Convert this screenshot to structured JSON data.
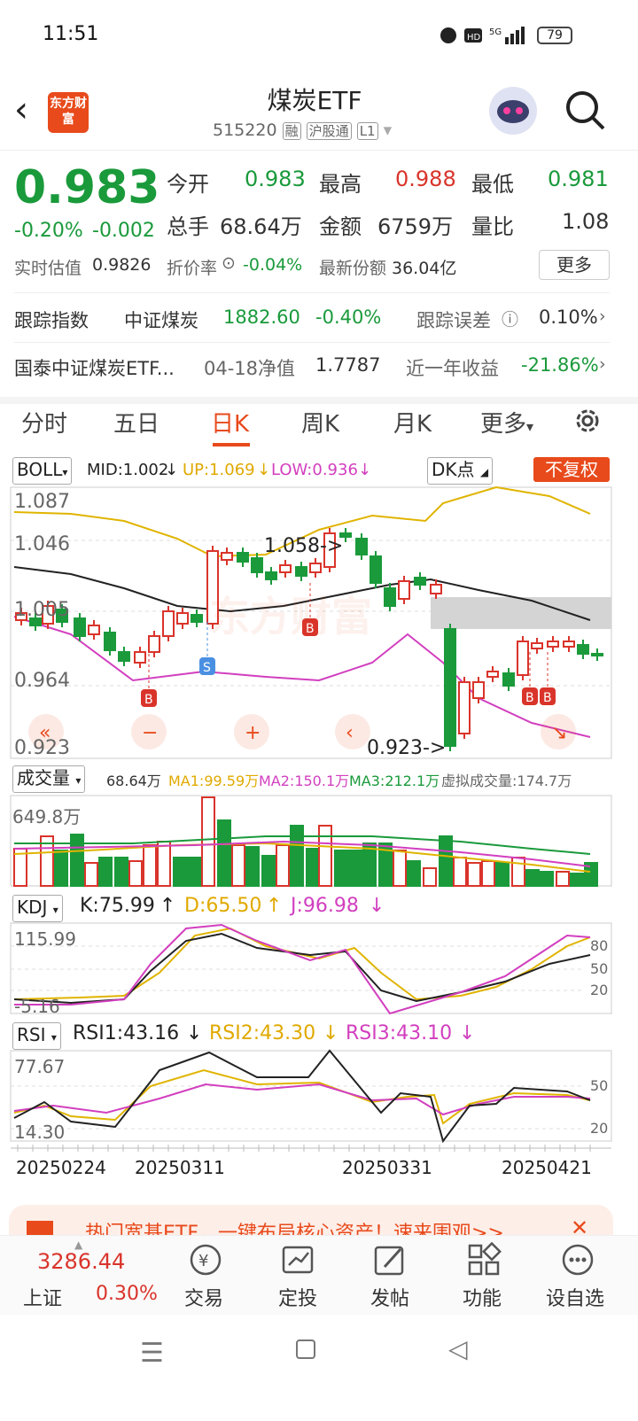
{
  "status": {
    "time": "11:51",
    "battery": "79"
  },
  "header": {
    "title": "煤炭ETF",
    "code": "515220",
    "tags": [
      "融",
      "沪股通",
      "L1"
    ],
    "logo": "东方财富"
  },
  "quote": {
    "price": "0.983",
    "pct": "-0.20%",
    "chg": "-0.002",
    "open_label": "今开",
    "open": "0.983",
    "high_label": "最高",
    "high": "0.988",
    "low_label": "最低",
    "low": "0.981",
    "vol_label": "总手",
    "vol": "68.64万",
    "amt_label": "金额",
    "amt": "6759万",
    "ratio_label": "量比",
    "ratio": "1.08",
    "iopv_label": "实时估值",
    "iopv": "0.9826",
    "prem_label": "折价率",
    "prem": "-0.04%",
    "share_label": "最新份额",
    "share": "36.04亿",
    "more": "更多"
  },
  "track": {
    "label": "跟踪指数",
    "index": "中证煤炭",
    "value": "1882.60",
    "pct": "-0.40%",
    "err_label": "跟踪误差",
    "err": "0.10%"
  },
  "fund": {
    "name": "国泰中证煤炭ETF...",
    "nav_label": "04-18净值",
    "nav": "1.7787",
    "ret_label": "近一年收益",
    "ret": "-21.86%"
  },
  "tabs": [
    "分时",
    "五日",
    "日K",
    "周K",
    "月K",
    "更多"
  ],
  "boll": {
    "name": "BOLL",
    "mid": "MID:1.002",
    "up": "UP:1.069",
    "low": "LOW:0.936",
    "dk": "DK点",
    "fq": "不复权",
    "axis": [
      "1.087",
      "1.046",
      "1.005",
      "0.964",
      "0.923"
    ],
    "max_note": "1.058->",
    "min_note": "0.923->",
    "marks": [
      "B",
      "S",
      "B",
      "B",
      "B"
    ],
    "watermark": "东方财富"
  },
  "volume": {
    "name": "成交量",
    "v": "68.64万",
    "ma1": "MA1:99.59万",
    "ma2": "MA2:150.1万",
    "ma3": "MA3:212.1万",
    "virt": "虚拟成交量:174.7万",
    "axis": "649.8万"
  },
  "kdj": {
    "name": "KDJ",
    "k": "K:75.99",
    "d": "D:65.50",
    "j": "J:96.98",
    "axis_top": "115.99",
    "axis_bot": "-5.16",
    "levels": [
      "80",
      "50",
      "20"
    ]
  },
  "rsi": {
    "name": "RSI",
    "r1": "RSI1:43.16",
    "r2": "RSI2:43.30",
    "r3": "RSI3:43.10",
    "axis_top": "77.67",
    "axis_bot": "14.30",
    "levels": [
      "50",
      "20"
    ]
  },
  "dates": [
    "20250224",
    "20250311",
    "20250331",
    "20250421"
  ],
  "banner": {
    "text": "热门宽基ETF，一键布局核心资产！速来围观>>"
  },
  "nav": {
    "index_value": "3286.44",
    "index_name": "上证",
    "index_pct": "0.30%",
    "items": [
      "交易",
      "定投",
      "发帖",
      "功能",
      "设自选"
    ]
  },
  "colors": {
    "up": "#d9342b",
    "down": "#1a9a3b",
    "accent": "#e84a1b"
  }
}
